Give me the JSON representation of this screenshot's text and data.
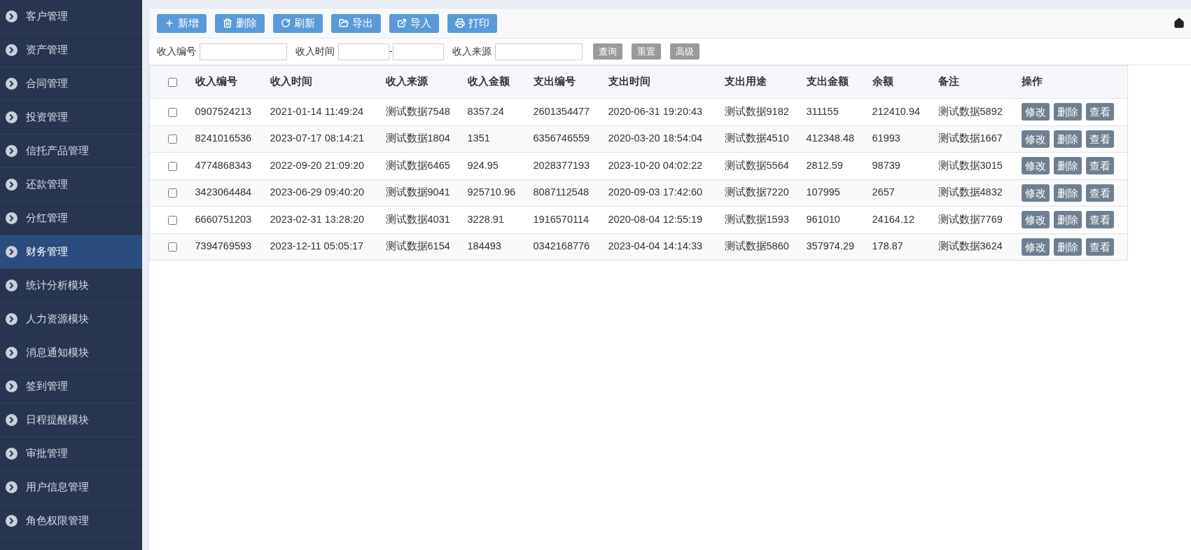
{
  "sidebar": {
    "items": [
      {
        "label": "客户管理",
        "selected": false
      },
      {
        "label": "资产管理",
        "selected": false
      },
      {
        "label": "合同管理",
        "selected": false
      },
      {
        "label": "投资管理",
        "selected": false
      },
      {
        "label": "信托产品管理",
        "selected": false
      },
      {
        "label": "还款管理",
        "selected": false
      },
      {
        "label": "分红管理",
        "selected": false
      },
      {
        "label": "财务管理",
        "selected": true
      },
      {
        "label": "统计分析模块",
        "selected": false
      },
      {
        "label": "人力资源模块",
        "selected": false
      },
      {
        "label": "消息通知模块",
        "selected": false
      },
      {
        "label": "签到管理",
        "selected": false
      },
      {
        "label": "日程提醒模块",
        "selected": false
      },
      {
        "label": "审批管理",
        "selected": false
      },
      {
        "label": "用户信息管理",
        "selected": false
      },
      {
        "label": "角色权限管理",
        "selected": false
      }
    ]
  },
  "toolbar": {
    "buttons": [
      {
        "label": "新增",
        "kind": "add"
      },
      {
        "label": "删除",
        "kind": "delete"
      },
      {
        "label": "刷新",
        "kind": "refresh"
      },
      {
        "label": "导出",
        "kind": "export"
      },
      {
        "label": "导入",
        "kind": "import"
      },
      {
        "label": "打印",
        "kind": "print"
      }
    ]
  },
  "filters": {
    "fields": [
      {
        "label": "收入编号",
        "kind": "single"
      },
      {
        "label": "收入时间",
        "kind": "range",
        "separator": "-"
      },
      {
        "label": "收入来源",
        "kind": "single"
      }
    ],
    "buttons": [
      "查询",
      "重置",
      "高级"
    ]
  },
  "table": {
    "header_checked": false,
    "columns": [
      "收入编号",
      "收入时间",
      "收入来源",
      "收入金额",
      "支出编号",
      "支出时间",
      "支出用途",
      "支出金额",
      "余额",
      "备注",
      "操作"
    ],
    "rows": [
      {
        "checked": false,
        "cells": [
          "0907524213",
          "2021-01-14 11:49:24",
          "测试数据7548",
          "8357.24",
          "2601354477",
          "2020-06-31 19:20:43",
          "测试数据9182",
          "311155",
          "212410.94",
          "测试数据5892"
        ],
        "actions": [
          "修改",
          "删除",
          "查看"
        ]
      },
      {
        "checked": false,
        "cells": [
          "8241016536",
          "2023-07-17 08:14:21",
          "测试数据1804",
          "1351",
          "6356746559",
          "2020-03-20 18:54:04",
          "测试数据4510",
          "412348.48",
          "61993",
          "测试数据1667"
        ],
        "actions": [
          "修改",
          "删除",
          "查看"
        ]
      },
      {
        "checked": false,
        "cells": [
          "4774868343",
          "2022-09-20 21:09:20",
          "测试数据6465",
          "924.95",
          "2028377193",
          "2023-10-20 04:02:22",
          "测试数据5564",
          "2812.59",
          "98739",
          "测试数据3015"
        ],
        "actions": [
          "修改",
          "删除",
          "查看"
        ]
      },
      {
        "checked": false,
        "cells": [
          "3423064484",
          "2023-06-29 09:40:20",
          "测试数据9041",
          "925710.96",
          "8087112548",
          "2020-09-03 17:42:60",
          "测试数据7220",
          "107995",
          "2657",
          "测试数据4832"
        ],
        "actions": [
          "修改",
          "删除",
          "查看"
        ]
      },
      {
        "checked": false,
        "cells": [
          "6660751203",
          "2023-02-31 13:28:20",
          "测试数据4031",
          "3228.91",
          "1916570114",
          "2020-08-04 12:55:19",
          "测试数据1593",
          "961010",
          "24164.12",
          "测试数据7769"
        ],
        "actions": [
          "修改",
          "删除",
          "查看"
        ]
      },
      {
        "checked": false,
        "cells": [
          "7394769593",
          "2023-12-11 05:05:17",
          "测试数据6154",
          "184493",
          "0342168776",
          "2023-04-04 14:14:33",
          "测试数据5860",
          "357974.29",
          "178.87",
          "测试数据3624"
        ],
        "actions": [
          "修改",
          "删除",
          "查看"
        ]
      }
    ]
  }
}
